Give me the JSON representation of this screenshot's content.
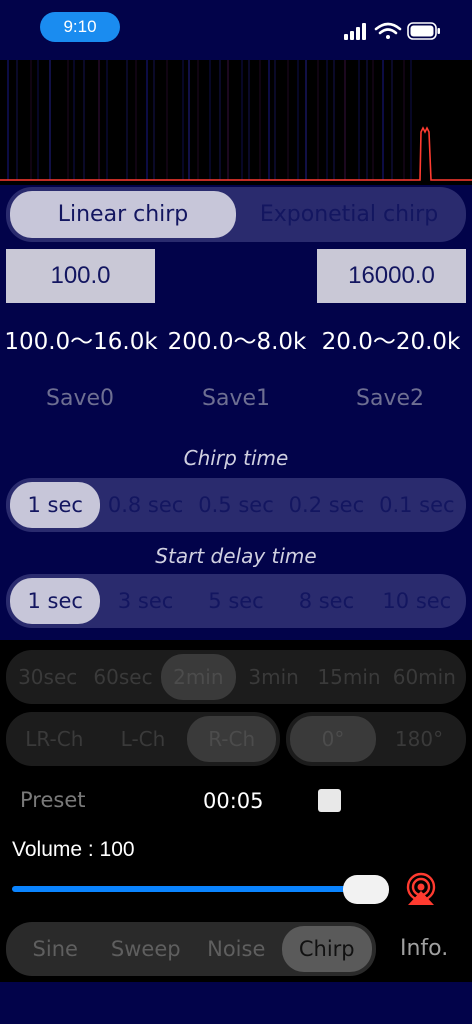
{
  "status": {
    "time": "9:10"
  },
  "colors": {
    "accent": "#0a84ff",
    "navy": "#02034a",
    "trace": "#ff3b30"
  },
  "chirp_mode": {
    "options": [
      "Linear chirp",
      "Exponetial chirp"
    ],
    "selected": 0
  },
  "freq": {
    "start": "100.0",
    "end": "16000.0"
  },
  "ranges": [
    "100.0〜16.0k",
    "200.0〜8.0k",
    "20.0〜20.0k"
  ],
  "saves": [
    "Save0",
    "Save1",
    "Save2"
  ],
  "chirp_time": {
    "title": "Chirp time",
    "options": [
      "1 sec",
      "0.8 sec",
      "0.5 sec",
      "0.2 sec",
      "0.1 sec"
    ],
    "selected": 0
  },
  "start_delay": {
    "title": "Start delay time",
    "options": [
      "1 sec",
      "3 sec",
      "5 sec",
      "8 sec",
      "10 sec"
    ],
    "selected": 0
  },
  "duration": {
    "options": [
      "30sec",
      "60sec",
      "2min",
      "3min",
      "15min",
      "60min"
    ],
    "selected": 2
  },
  "channel": {
    "options": [
      "LR-Ch",
      "L-Ch",
      "R-Ch"
    ],
    "selected": 2
  },
  "phase": {
    "options": [
      "0°",
      "180°"
    ],
    "selected": 0
  },
  "preset": {
    "label": "Preset"
  },
  "timer": {
    "value": "00:05"
  },
  "volume": {
    "label": "Volume : 100",
    "value": 100
  },
  "modes": {
    "options": [
      "Sine",
      "Sweep",
      "Noise",
      "Chirp"
    ],
    "selected": 3
  },
  "info": {
    "label": "Info."
  },
  "icons": {
    "wifi": "wifi-icon",
    "signal": "cellular-signal-icon",
    "battery": "battery-icon",
    "airplay": "airplay-icon"
  }
}
